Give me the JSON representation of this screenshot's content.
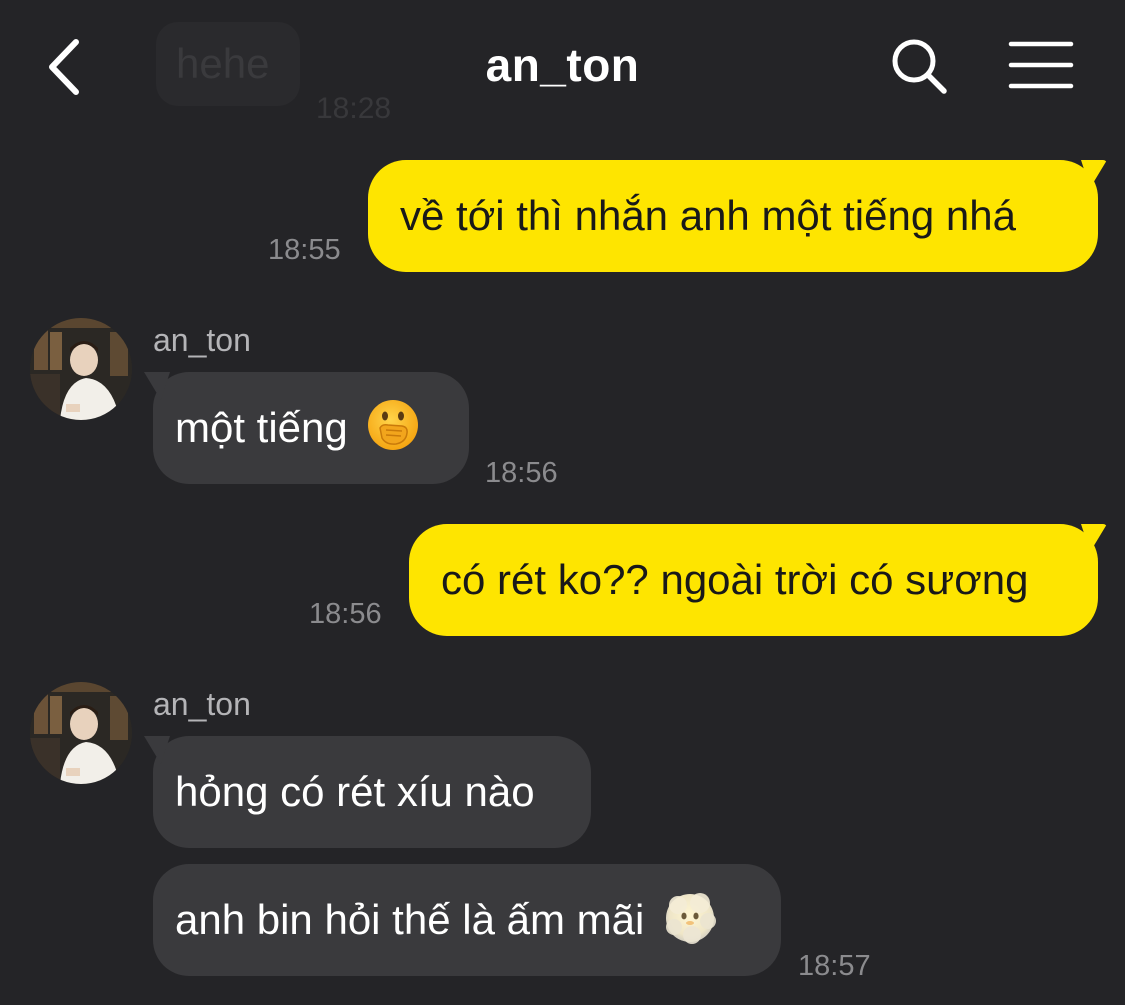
{
  "header": {
    "title": "an_ton",
    "back_icon": "chevron-left-icon",
    "search_icon": "search-icon",
    "menu_icon": "hamburger-menu-icon"
  },
  "ghost_message": {
    "text": "hehe",
    "time": "18:28"
  },
  "messages": [
    {
      "direction": "outgoing",
      "text": "về tới thì nhắn anh một tiếng nhá",
      "time": "18:55"
    },
    {
      "direction": "incoming",
      "sender": "an_ton",
      "text": "một tiếng",
      "emoji": "face-with-hand-over-mouth",
      "time": "18:56"
    },
    {
      "direction": "outgoing",
      "text": "có rét ko?? ngoài trời có sương",
      "time": "18:56"
    },
    {
      "direction": "incoming",
      "sender": "an_ton",
      "text": "hỏng có rét xíu nào"
    },
    {
      "direction": "incoming",
      "text": "anh bin hỏi thế là ấm mãi",
      "emoji": "cloud-face",
      "time": "18:57"
    }
  ],
  "colors": {
    "background": "#242427",
    "outgoing_bubble": "#fee500",
    "incoming_bubble": "#3a3a3d",
    "timestamp": "#8b8b8e"
  }
}
